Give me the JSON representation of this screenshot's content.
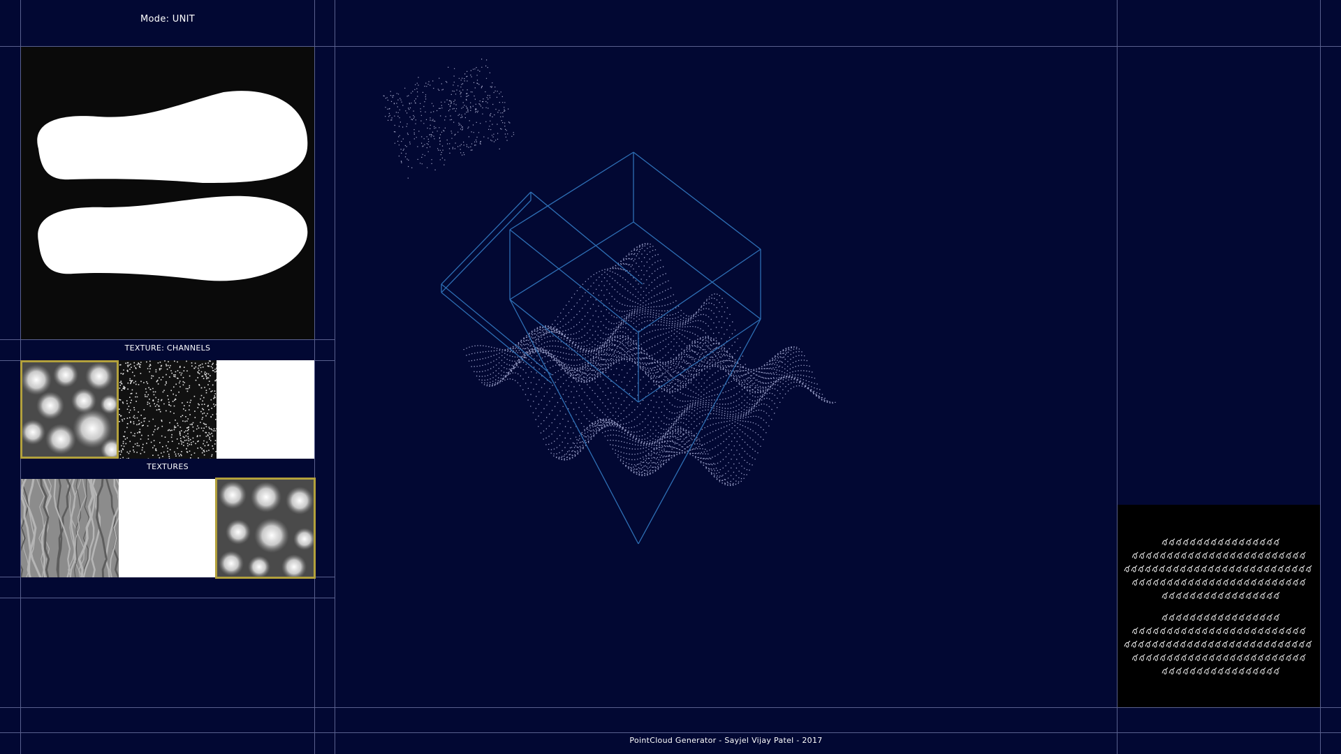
{
  "header": {
    "mode_text": "Mode: UNIT"
  },
  "left_panel": {
    "mask_preview": {
      "name": "shoe-sole-mask"
    },
    "channels_label": "TEXTURE: CHANNELS",
    "textures_label": "TEXTURES",
    "channel_tiles": [
      {
        "name": "blob-noise",
        "selected": true
      },
      {
        "name": "dot-scatter",
        "selected": false
      },
      {
        "name": "blank",
        "selected": false
      }
    ],
    "texture_tiles": [
      {
        "name": "wrinkle-noise",
        "selected": false
      },
      {
        "name": "blank",
        "selected": false
      },
      {
        "name": "blob-noise",
        "selected": true
      }
    ]
  },
  "viewport": {
    "point_color": "#b9bde6",
    "box_color": "#2e6fb5"
  },
  "preview": {
    "name": "output-pattern-preview"
  },
  "footer": {
    "credit": "PointCloud Generator - Sayjel Vijay Patel - 2017"
  },
  "colors": {
    "background": "#020833",
    "grid": "#59608e",
    "selection": "#b3a13c"
  }
}
